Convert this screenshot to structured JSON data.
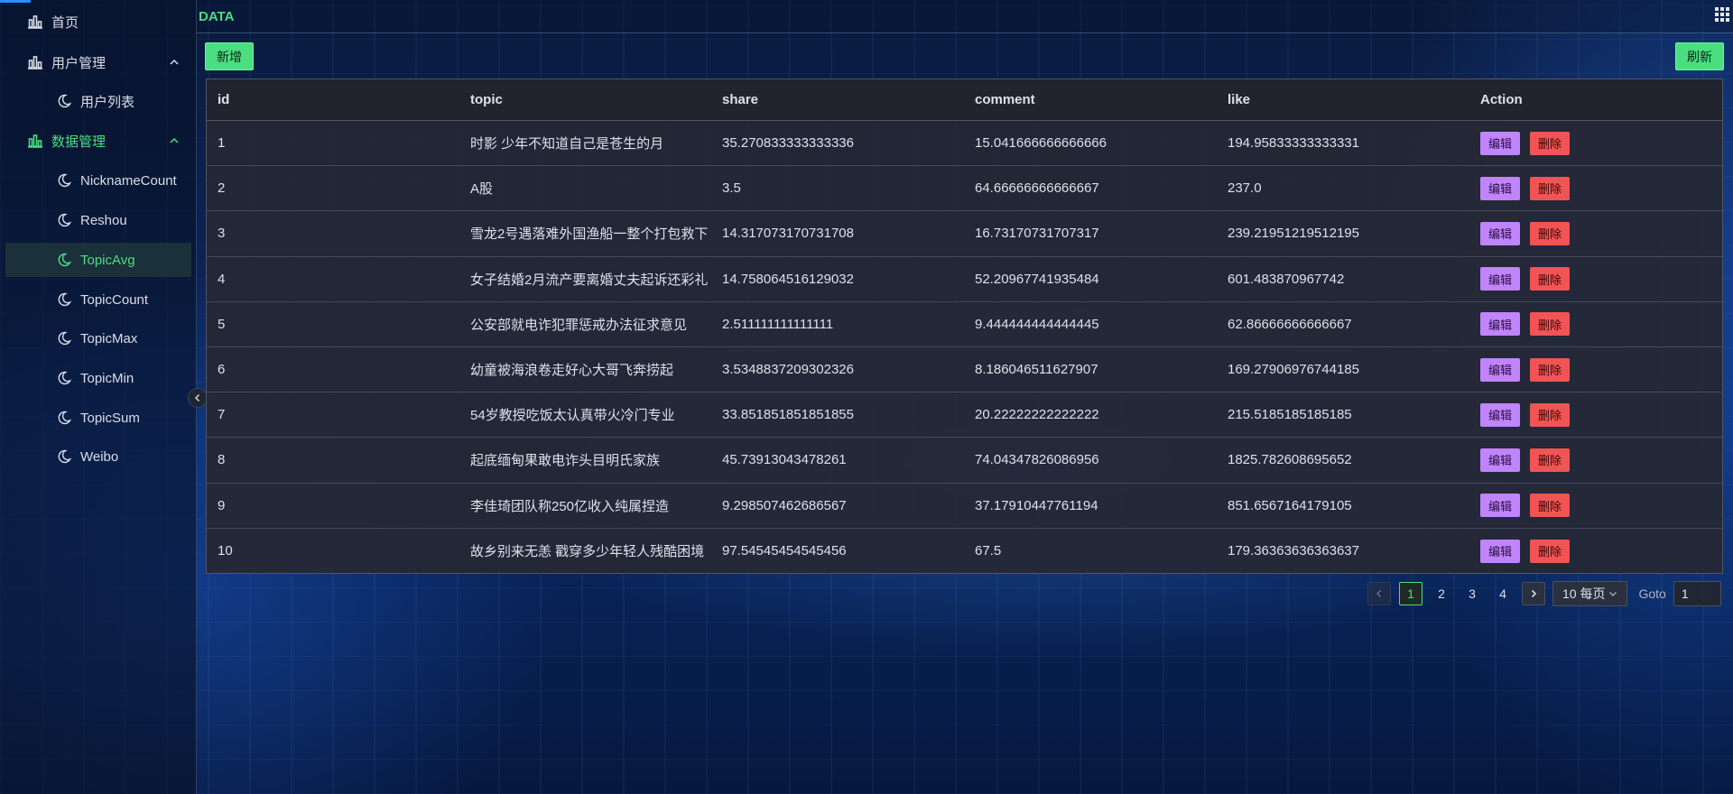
{
  "header": {
    "title": "DATA"
  },
  "sidebar": {
    "items": [
      {
        "label": "首页"
      },
      {
        "label": "用户管理"
      },
      {
        "label": "用户列表"
      },
      {
        "label": "数据管理"
      },
      {
        "label": "NicknameCount"
      },
      {
        "label": "Reshou"
      },
      {
        "label": "TopicAvg"
      },
      {
        "label": "TopicCount"
      },
      {
        "label": "TopicMax"
      },
      {
        "label": "TopicMin"
      },
      {
        "label": "TopicSum"
      },
      {
        "label": "Weibo"
      }
    ],
    "selected": "TopicAvg",
    "active_group": "数据管理"
  },
  "toolbar": {
    "add_label": "新增",
    "refresh_label": "刷新"
  },
  "table": {
    "columns": [
      "id",
      "topic",
      "share",
      "comment",
      "like",
      "Action"
    ],
    "edit_label": "编辑",
    "delete_label": "删除",
    "rows": [
      {
        "id": "1",
        "topic": "时影 少年不知道自己是苍生的月",
        "share": "35.270833333333336",
        "comment": "15.041666666666666",
        "like": "194.95833333333331"
      },
      {
        "id": "2",
        "topic": "A股",
        "share": "3.5",
        "comment": "64.66666666666667",
        "like": "237.0"
      },
      {
        "id": "3",
        "topic": "雪龙2号遇落难外国渔船一整个打包救下",
        "share": "14.317073170731708",
        "comment": "16.73170731707317",
        "like": "239.21951219512195"
      },
      {
        "id": "4",
        "topic": "女子结婚2月流产要离婚丈夫起诉还彩礼",
        "share": "14.758064516129032",
        "comment": "52.20967741935484",
        "like": "601.483870967742"
      },
      {
        "id": "5",
        "topic": "公安部就电诈犯罪惩戒办法征求意见",
        "share": "2.511111111111111",
        "comment": "9.444444444444445",
        "like": "62.86666666666667"
      },
      {
        "id": "6",
        "topic": "幼童被海浪卷走好心大哥飞奔捞起",
        "share": "3.5348837209302326",
        "comment": "8.186046511627907",
        "like": "169.27906976744185"
      },
      {
        "id": "7",
        "topic": "54岁教授吃饭太认真带火冷门专业",
        "share": "33.851851851851855",
        "comment": "20.22222222222222",
        "like": "215.5185185185185"
      },
      {
        "id": "8",
        "topic": "起底缅甸果敢电诈头目明氏家族",
        "share": "45.73913043478261",
        "comment": "74.04347826086956",
        "like": "1825.782608695652"
      },
      {
        "id": "9",
        "topic": "李佳琦团队称250亿收入纯属捏造",
        "share": "9.298507462686567",
        "comment": "37.17910447761194",
        "like": "851.6567164179105"
      },
      {
        "id": "10",
        "topic": "故乡别来无恙 戳穿多少年轻人残酷困境",
        "share": "97.54545454545456",
        "comment": "67.5",
        "like": "179.36363636363637"
      }
    ]
  },
  "pagination": {
    "pages": [
      "1",
      "2",
      "3",
      "4"
    ],
    "current": "1",
    "page_size_label": "10 每页",
    "goto_label": "Goto",
    "goto_value": "1"
  },
  "icons": {
    "sidebar_top": "chart-bar-icon",
    "sidebar_child": "moon-icon",
    "header_right": "grid-apps-icon"
  },
  "colors": {
    "accent": "#4ade80",
    "edit": "#c084fc",
    "delete": "#f05454"
  }
}
